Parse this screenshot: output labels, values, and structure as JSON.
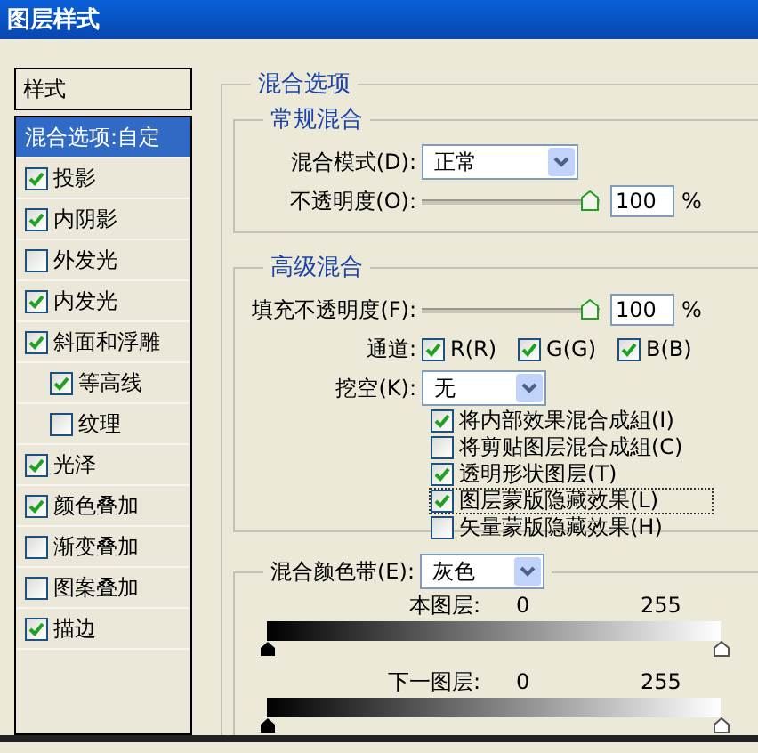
{
  "window": {
    "title": "图层样式"
  },
  "sidebar": {
    "header": "样式",
    "items": [
      {
        "label": "混合选项:自定",
        "kind": "plain",
        "selected": true
      },
      {
        "label": "投影",
        "kind": "check",
        "checked": true,
        "selected": false
      },
      {
        "label": "内阴影",
        "kind": "check",
        "checked": true,
        "selected": false
      },
      {
        "label": "外发光",
        "kind": "check",
        "checked": false,
        "selected": false
      },
      {
        "label": "内发光",
        "kind": "check",
        "checked": true,
        "selected": false
      },
      {
        "label": "斜面和浮雕",
        "kind": "check",
        "checked": true,
        "selected": false,
        "children": [
          {
            "label": "等高线",
            "kind": "check",
            "checked": true,
            "selected": false
          },
          {
            "label": "纹理",
            "kind": "check",
            "checked": false,
            "selected": false
          }
        ]
      },
      {
        "label": "光泽",
        "kind": "check",
        "checked": true,
        "selected": false
      },
      {
        "label": "颜色叠加",
        "kind": "check",
        "checked": true,
        "selected": false
      },
      {
        "label": "渐变叠加",
        "kind": "check",
        "checked": false,
        "selected": false
      },
      {
        "label": "图案叠加",
        "kind": "check",
        "checked": false,
        "selected": false
      },
      {
        "label": "描边",
        "kind": "check",
        "checked": true,
        "selected": false
      }
    ]
  },
  "blending_options": {
    "title": "混合选项",
    "general": {
      "title": "常规混合",
      "blend_mode": {
        "label": "混合模式(D):",
        "value": "正常"
      },
      "opacity": {
        "label": "不透明度(O):",
        "level": 1,
        "value": "100",
        "unit": "%"
      }
    },
    "advanced": {
      "title": "高级混合",
      "fill_opacity": {
        "label": "填充不透明度(F):",
        "level": 1,
        "value": "100",
        "unit": "%"
      },
      "channels": {
        "label": "通道:",
        "items": [
          {
            "label": "R(R)",
            "checked": true
          },
          {
            "label": "G(G)",
            "checked": true
          },
          {
            "label": "B(B)",
            "checked": true
          }
        ]
      },
      "knockout": {
        "label": "挖空(K):",
        "value": "无"
      },
      "options": [
        {
          "label": "将内部效果混合成組(I)",
          "checked": true,
          "focused": false
        },
        {
          "label": "将剪贴图层混合成組(C)",
          "checked": false,
          "focused": false
        },
        {
          "label": "透明形状图层(T)",
          "checked": true,
          "focused": false
        },
        {
          "label": "图层蒙版隐藏效果(L)",
          "checked": true,
          "focused": true
        },
        {
          "label": "矢量蒙版隐藏效果(H)",
          "checked": false,
          "focused": false
        }
      ]
    },
    "blend_if": {
      "label": "混合颜色带(E):",
      "value": "灰色",
      "this_layer": {
        "label": "本图层:",
        "low": "0",
        "high": "255"
      },
      "underlying_layer": {
        "label": "下一图层:",
        "low": "0",
        "high": "255"
      }
    }
  }
}
